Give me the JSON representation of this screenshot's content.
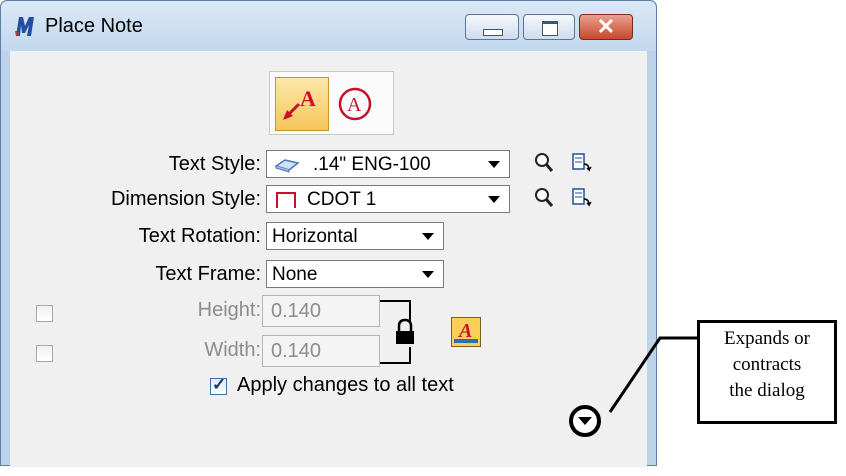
{
  "window": {
    "title": "Place Note"
  },
  "modes": [
    {
      "name": "place-note",
      "icon": "note-with-leader-icon",
      "glyph": "A",
      "active": true
    },
    {
      "name": "place-text",
      "icon": "circled-a-icon",
      "glyph": "A",
      "active": false
    }
  ],
  "text_style": {
    "label": "Text Style:",
    "value": ".14\"  ENG-100"
  },
  "dimension_style": {
    "label": "Dimension Style:",
    "value": "CDOT 1"
  },
  "text_rotation": {
    "label": "Text Rotation:",
    "value": "Horizontal"
  },
  "text_frame": {
    "label": "Text Frame:",
    "value": "None"
  },
  "height": {
    "label": "Height:",
    "value": "0.140"
  },
  "width": {
    "label": "Width:",
    "value": "0.140"
  },
  "apply_all": {
    "label": "Apply changes to all text",
    "checked": true
  },
  "callout": {
    "lines": [
      "Expands or",
      "contracts",
      "the dialog"
    ]
  },
  "colors": {
    "titlebar": "#c3d8ee",
    "client": "#f0f0f0",
    "active_mode": "#f8c55c",
    "close": "#c9482e"
  }
}
